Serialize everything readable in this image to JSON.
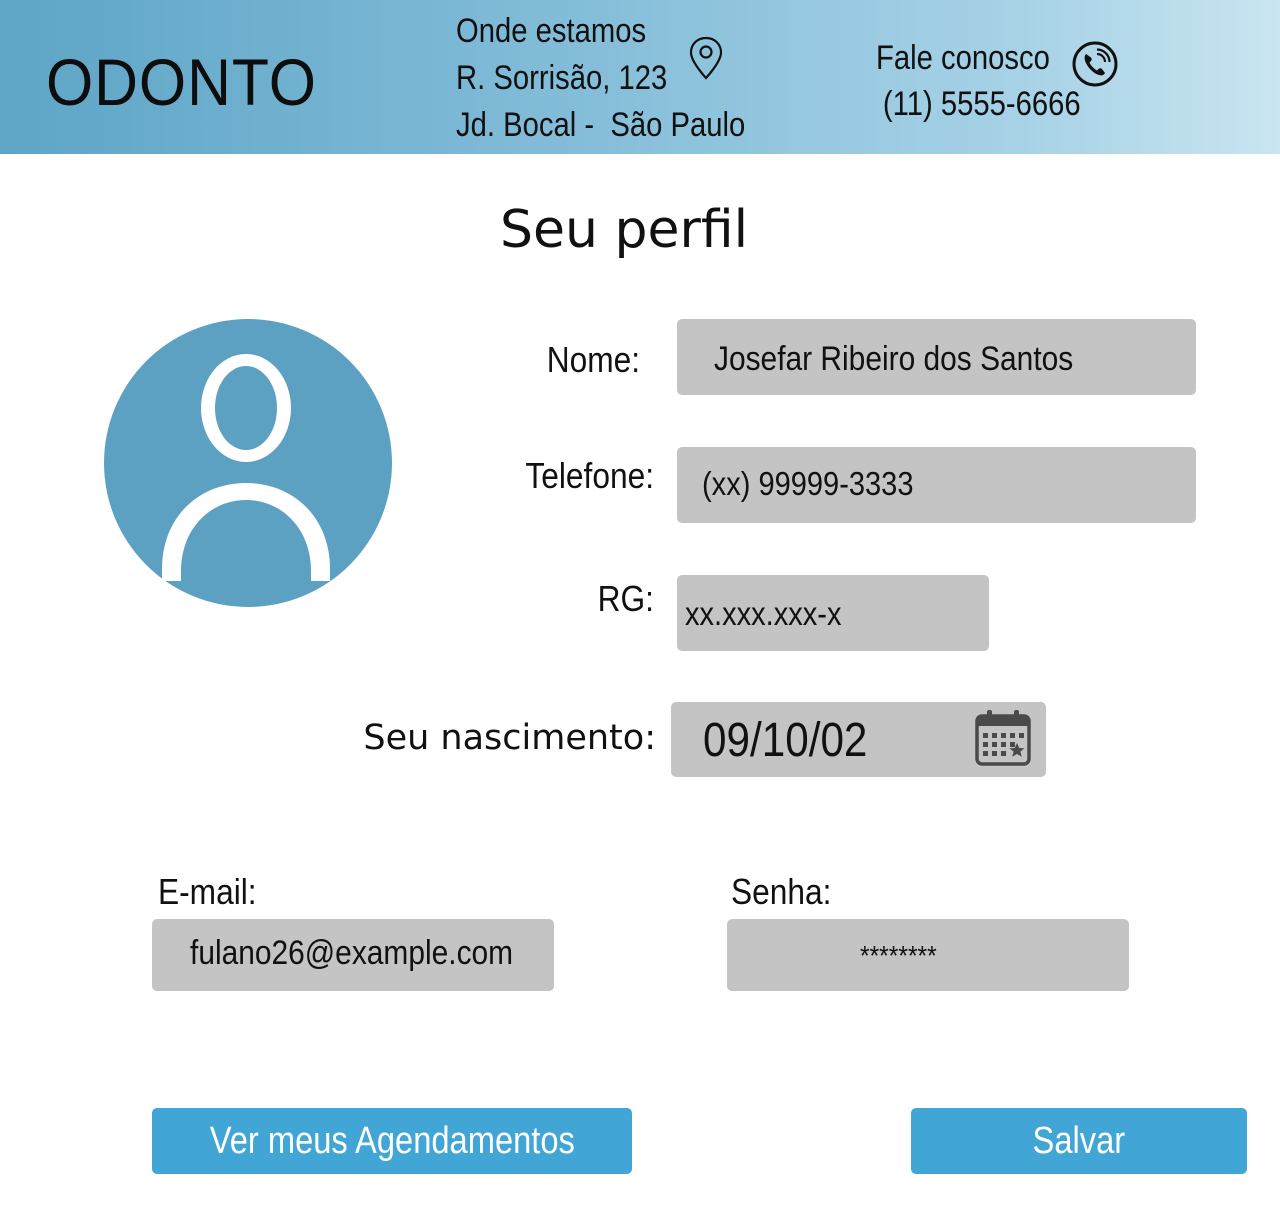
{
  "header": {
    "brand": "ODONTO",
    "location": {
      "title": "Onde estamos",
      "street": "R. Sorrisão, 123",
      "district": "Jd. Bocal -  São Paulo",
      "icon": "location-pin-icon"
    },
    "contact": {
      "title": "Fale conosco",
      "phone": "(11) 5555-6666",
      "icon": "phone-icon"
    },
    "colors": {
      "gradient_start": "#5ea5c6",
      "gradient_end": "#c9e5f1"
    }
  },
  "page": {
    "title": "Seu perfil"
  },
  "profile": {
    "avatar_icon": "user-avatar-icon",
    "avatar_color": "#5ca1c2",
    "fields": {
      "name": {
        "label": "Nome:",
        "value": "Josefar Ribeiro dos Santos"
      },
      "phone": {
        "label": "Telefone:",
        "value": "(xx) 99999-3333"
      },
      "rg": {
        "label": "RG:",
        "value": "xx.xxx.xxx-x"
      },
      "birth": {
        "label": "Seu nascimento:",
        "value": "09/10/02",
        "icon": "calendar-icon"
      },
      "email": {
        "label": "E-mail:",
        "value": "fulano26@example.com"
      },
      "password": {
        "label": "Senha:",
        "value": "********"
      }
    },
    "field_color": "#c4c4c4"
  },
  "actions": {
    "appointments_label": "Ver meus Agendamentos",
    "save_label": "Salvar",
    "button_color": "#41a6d6"
  }
}
